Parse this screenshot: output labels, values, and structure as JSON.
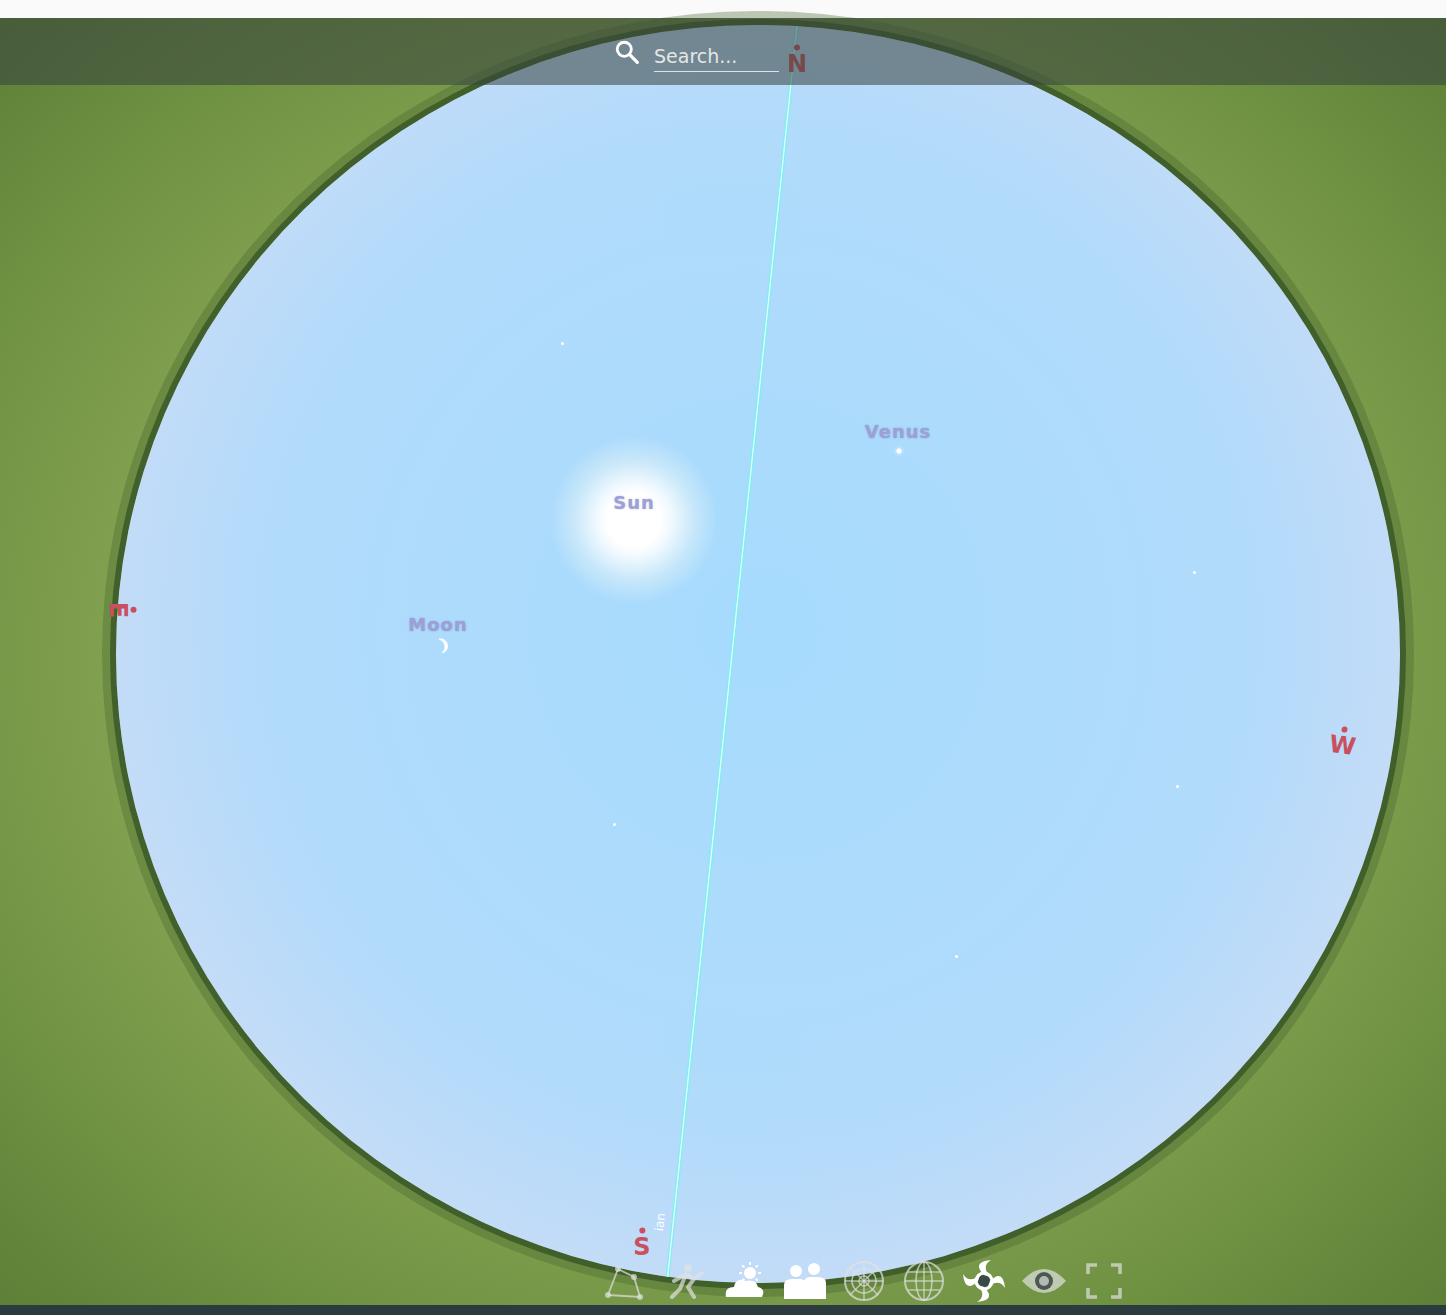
{
  "search": {
    "placeholder": "Search..."
  },
  "compass": [
    {
      "label": "N"
    },
    {
      "label": "E"
    },
    {
      "label": "W"
    },
    {
      "label": "S"
    }
  ],
  "sky_objects": [
    {
      "name": "Sun",
      "kind": "sun"
    },
    {
      "name": "Moon",
      "kind": "moon"
    },
    {
      "name": "Venus",
      "kind": "planet"
    }
  ],
  "meridian": {
    "label": "ian"
  },
  "toolbar": [
    {
      "kind": "lines",
      "active": false
    },
    {
      "kind": "art",
      "active": false
    },
    {
      "kind": "atmosphere",
      "active": true
    },
    {
      "kind": "landscape",
      "active": true
    },
    {
      "kind": "azimuthal",
      "active": false
    },
    {
      "kind": "equatorial",
      "active": false
    },
    {
      "kind": "dso",
      "active": true
    },
    {
      "kind": "night",
      "active": false
    },
    {
      "kind": "fullscreen",
      "active": false
    }
  ]
}
